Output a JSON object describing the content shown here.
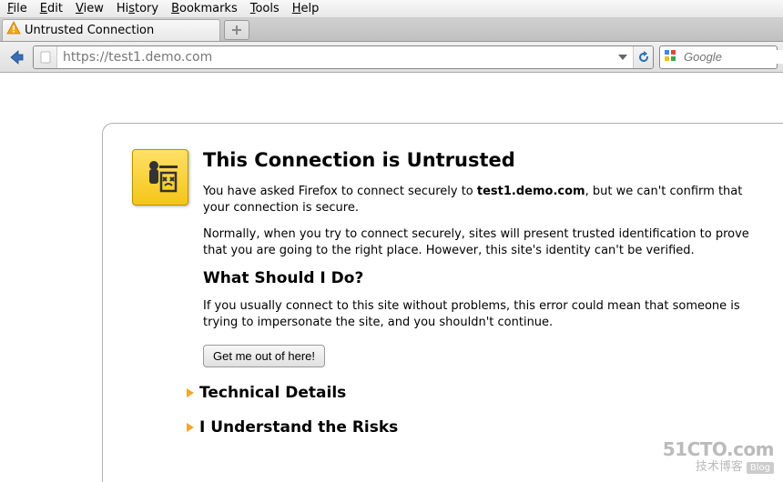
{
  "menubar": {
    "file": "File",
    "edit": "Edit",
    "view": "View",
    "history": "History",
    "bookmarks": "Bookmarks",
    "tools": "Tools",
    "help": "Help"
  },
  "tab": {
    "title": "Untrusted Connection"
  },
  "urlbar": {
    "prefix": "https://test1.",
    "domain": "demo.com"
  },
  "search": {
    "placeholder": "Google"
  },
  "error": {
    "title": "This Connection is Untrusted",
    "p1_before": "You have asked Firefox to connect securely to ",
    "p1_host": "test1.demo.com",
    "p1_after": ", but we can't confirm that your connection is secure.",
    "p2": "Normally, when you try to connect securely, sites will present trusted identification to prove that you are going to the right place. However, this site's identity can't be verified.",
    "subtitle": "What Should I Do?",
    "p3": "If you usually connect to this site without problems, this error could mean that someone is trying to impersonate the site, and you shouldn't continue.",
    "button": "Get me out of here!",
    "expand1": "Technical Details",
    "expand2": "I Understand the Risks"
  },
  "watermark": {
    "line1": "51CTO.com",
    "line2": "技术博客",
    "badge": "Blog"
  }
}
